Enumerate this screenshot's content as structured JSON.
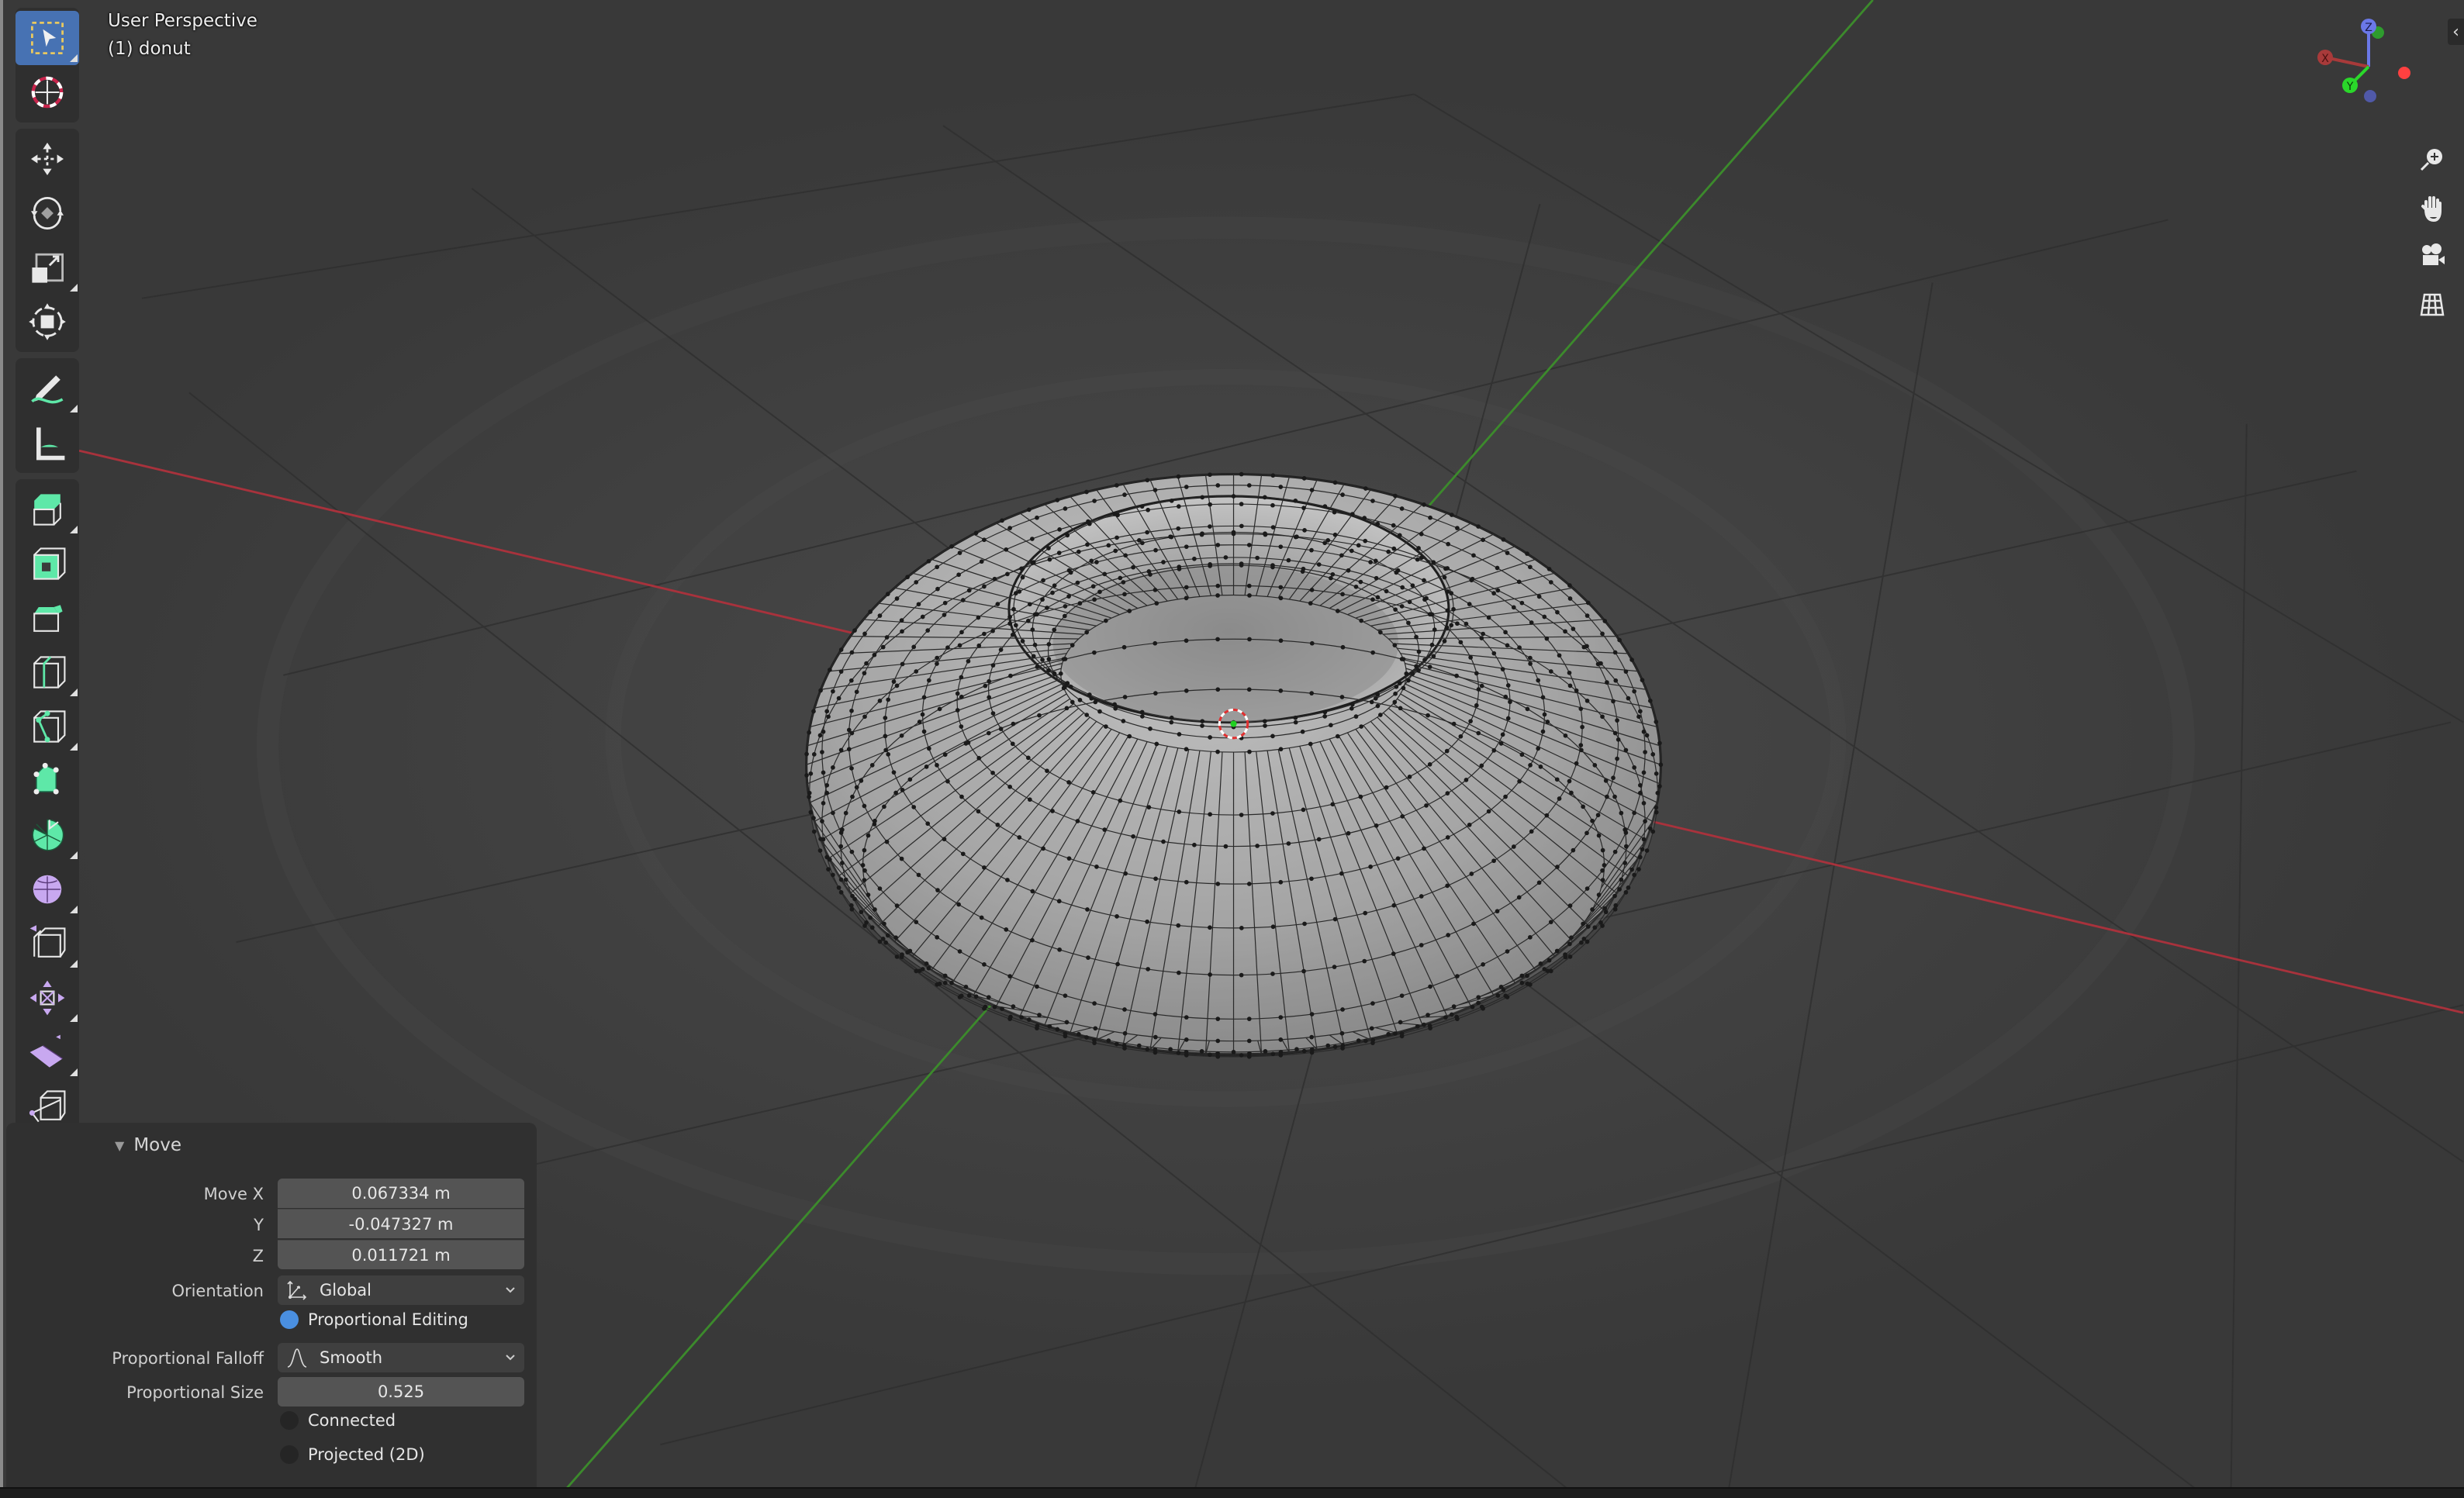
{
  "viewport": {
    "view_name": "User Perspective",
    "object_label": "(1) donut",
    "object_name": "donut"
  },
  "toolbar": {
    "tools": [
      {
        "id": "select-box",
        "icon": "select-box-icon",
        "active": true
      },
      {
        "id": "cursor",
        "icon": "cursor-icon",
        "active": false
      },
      {
        "id": "move",
        "icon": "move-icon",
        "active": false
      },
      {
        "id": "rotate",
        "icon": "rotate-icon",
        "active": false
      },
      {
        "id": "scale",
        "icon": "scale-icon",
        "active": false
      },
      {
        "id": "transform",
        "icon": "transform-icon",
        "active": false
      },
      {
        "id": "annotate",
        "icon": "annotate-icon",
        "active": false
      },
      {
        "id": "measure",
        "icon": "measure-icon",
        "active": false
      },
      {
        "id": "extrude-region",
        "icon": "extrude-region-icon",
        "active": false
      },
      {
        "id": "inset-faces",
        "icon": "inset-faces-icon",
        "active": false
      },
      {
        "id": "bevel",
        "icon": "bevel-icon",
        "active": false
      },
      {
        "id": "loop-cut",
        "icon": "loop-cut-icon",
        "active": false
      },
      {
        "id": "knife",
        "icon": "knife-icon",
        "active": false
      },
      {
        "id": "poly-build",
        "icon": "poly-build-icon",
        "active": false
      },
      {
        "id": "spin",
        "icon": "spin-icon",
        "active": false
      },
      {
        "id": "smooth",
        "icon": "smooth-icon",
        "active": false
      },
      {
        "id": "edge-slide",
        "icon": "edge-slide-icon",
        "active": false
      },
      {
        "id": "shrink-fatten",
        "icon": "shrink-fatten-icon",
        "active": false
      },
      {
        "id": "shear",
        "icon": "shear-icon",
        "active": false
      },
      {
        "id": "rip-region",
        "icon": "rip-region-icon",
        "active": false
      }
    ]
  },
  "gizmo": {
    "axes": [
      {
        "label": "X",
        "color": "#c23b3b"
      },
      {
        "label": "Y",
        "color": "#2ad82a"
      },
      {
        "label": "Z",
        "color": "#6b78e8"
      }
    ],
    "negative_colors": {
      "x": "#ff4040",
      "y": "#2e9c2e",
      "z": "#5059a8"
    }
  },
  "nav_buttons": [
    {
      "id": "zoom",
      "icon": "zoom-icon"
    },
    {
      "id": "pan",
      "icon": "hand-icon"
    },
    {
      "id": "camera",
      "icon": "camera-icon"
    },
    {
      "id": "ortho",
      "icon": "grid-icon"
    }
  ],
  "sidebar_toggle": "‹",
  "operator_panel": {
    "title": "Move",
    "move_x_label": "Move X",
    "move_x": "0.067334 m",
    "move_y_label": "Y",
    "move_y": "-0.047327 m",
    "move_z_label": "Z",
    "move_z": "0.011721 m",
    "orientation_label": "Orientation",
    "orientation": "Global",
    "proportional_editing_label": "Proportional Editing",
    "proportional_editing": true,
    "falloff_label": "Proportional Falloff",
    "falloff": "Smooth",
    "size_label": "Proportional Size",
    "size": "0.525",
    "connected_label": "Connected",
    "connected": false,
    "projected_label": "Projected (2D)",
    "projected": false
  },
  "colors": {
    "accent": "#4772b3",
    "x_axis": "#a8323c",
    "y_axis": "#3c8a2c",
    "checkbox_on": "#4a8fe0"
  }
}
